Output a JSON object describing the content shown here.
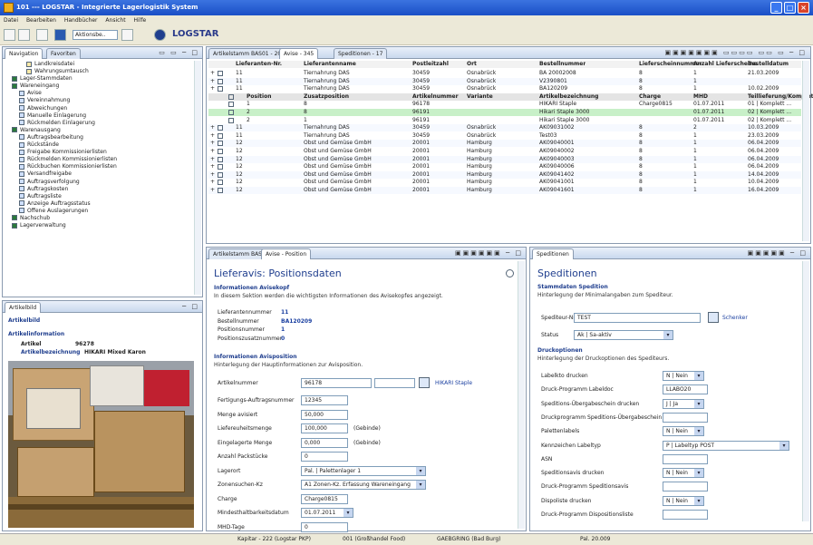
{
  "window": {
    "title": "101 --- LOGSTAR - Integrierte Lagerlogistik System"
  },
  "menu": [
    "Datei",
    "Bearbeiten",
    "Handbücher",
    "Ansicht",
    "Hilfe"
  ],
  "toolbar": {
    "combo": "Aktionsbe..",
    "brand": "LOGSTAR"
  },
  "nav": {
    "tabs": [
      "Navigation",
      "Favoriten"
    ],
    "items": [
      {
        "label": "Landkreisdatei",
        "indent": 3
      },
      {
        "label": "Wahrungsumtausch",
        "indent": 3
      },
      {
        "label": "Lager-Stammdaten",
        "indent": 1
      },
      {
        "label": "Wareneingang",
        "indent": 1
      },
      {
        "label": "Avise",
        "indent": 2
      },
      {
        "label": "Vereinnahmung",
        "indent": 2
      },
      {
        "label": "Abweichungen",
        "indent": 2
      },
      {
        "label": "Manuelle Einlagerung",
        "indent": 2
      },
      {
        "label": "Rückmelden Einlagerung",
        "indent": 2
      },
      {
        "label": "Warenausgang",
        "indent": 1
      },
      {
        "label": "Auftragsbearbeitung",
        "indent": 2
      },
      {
        "label": "Rückstände",
        "indent": 2
      },
      {
        "label": "Freigabe Kommissionierlisten",
        "indent": 2
      },
      {
        "label": "Rückmelden Kommissionierlisten",
        "indent": 2
      },
      {
        "label": "Rückbuchen Kommissionierlisten",
        "indent": 2
      },
      {
        "label": "Versandfreigabe",
        "indent": 2
      },
      {
        "label": "Auftragsverfolgung",
        "indent": 2
      },
      {
        "label": "Auftragskosten",
        "indent": 2
      },
      {
        "label": "Auftragsliste",
        "indent": 2
      },
      {
        "label": "Anzeige Auftragsstatus",
        "indent": 2
      },
      {
        "label": "Offene Auslagerungen",
        "indent": 2
      },
      {
        "label": "Nachschub",
        "indent": 1
      },
      {
        "label": "Lagerverwaltung",
        "indent": 1
      }
    ]
  },
  "article": {
    "tab": "Artikelbild",
    "title": "Artikelbild",
    "section": "Artikelinformation",
    "artikel_label": "Artikel",
    "artikel_value": "96278",
    "bez_label": "Artikelbezeichnung",
    "bez_value": "HIKARI Mixed Karon"
  },
  "grid": {
    "tabs": [
      "Artikelstamm BAS01 - 20",
      "Avise - 345",
      "Speditionen - 17"
    ],
    "headers": [
      "Lieferanten-Nr.",
      "Lieferantenname",
      "Postleitzahl",
      "Ort",
      "Bestellnummer",
      "Lieferscheinnummer",
      "Anzahl Lieferscheine",
      "Bestelldatum"
    ],
    "subheaders": [
      "Position",
      "Zusatzposition",
      "Artikelnummer",
      "Variante",
      "Artikelbezeichnung",
      "Charge",
      "MHD",
      "Teillieferung/Komplett"
    ],
    "rows": [
      {
        "t": "m",
        "c": [
          "11",
          "Tiernahrung DAS",
          "30459",
          "Osnabrück",
          "BA 20002008",
          "8",
          "1",
          "21.03.2009"
        ]
      },
      {
        "t": "m",
        "c": [
          "11",
          "Tiernahrung DAS",
          "30459",
          "Osnabrück",
          "V2390801",
          "8",
          "1",
          ""
        ]
      },
      {
        "t": "m",
        "c": [
          "11",
          "Tiernahrung DAS",
          "30459",
          "Osnabrück",
          "BA120209",
          "8",
          "1",
          "10.02.2009"
        ]
      },
      {
        "t": "h",
        "c": [
          "Position",
          "Zusatzposition",
          "Artikelnummer",
          "Variante",
          "Artikelbezeichnung",
          "Charge",
          "MHD",
          "Teillieferung/Komplett"
        ]
      },
      {
        "t": "s",
        "c": [
          "1",
          "8",
          "96178",
          "",
          "HIKARI Staple",
          "Charge0815",
          "01.07.2011",
          "01 | Komplett ..."
        ]
      },
      {
        "t": "g",
        "c": [
          "2",
          "8",
          "96191",
          "",
          "Hikari Staple 3000",
          "",
          "01.07.2011",
          "02 | Komplett ..."
        ]
      },
      {
        "t": "s",
        "c": [
          "2",
          "1",
          "96191",
          "",
          "Hikari Staple 3000",
          "",
          "01.07.2011",
          "02 | Komplett ..."
        ]
      },
      {
        "t": "m",
        "c": [
          "11",
          "Tiernahrung DAS",
          "30459",
          "Osnabrück",
          "AK09031002",
          "8",
          "2",
          "10.03.2009"
        ]
      },
      {
        "t": "m",
        "c": [
          "11",
          "Tiernahrung DAS",
          "30459",
          "Osnabrück",
          "Test03",
          "8",
          "1",
          "23.03.2009"
        ]
      },
      {
        "t": "m",
        "c": [
          "12",
          "Obst und Gemüse GmbH",
          "20001",
          "Hamburg",
          "AK09040001",
          "8",
          "1",
          "06.04.2009"
        ]
      },
      {
        "t": "m",
        "c": [
          "12",
          "Obst und Gemüse GmbH",
          "20001",
          "Hamburg",
          "AK09040002",
          "8",
          "1",
          "06.04.2009"
        ]
      },
      {
        "t": "m",
        "c": [
          "12",
          "Obst und Gemüse GmbH",
          "20001",
          "Hamburg",
          "AK09040003",
          "8",
          "1",
          "06.04.2009"
        ]
      },
      {
        "t": "m",
        "c": [
          "12",
          "Obst und Gemüse GmbH",
          "20001",
          "Hamburg",
          "AK09040006",
          "8",
          "1",
          "06.04.2009"
        ]
      },
      {
        "t": "m",
        "c": [
          "12",
          "Obst und Gemüse GmbH",
          "20001",
          "Hamburg",
          "AK09041402",
          "8",
          "1",
          "14.04.2009"
        ]
      },
      {
        "t": "m",
        "c": [
          "12",
          "Obst und Gemüse GmbH",
          "20001",
          "Hamburg",
          "AK09041001",
          "8",
          "1",
          "10.04.2009"
        ]
      },
      {
        "t": "m",
        "c": [
          "12",
          "Obst und Gemüse GmbH",
          "20001",
          "Hamburg",
          "AK09041601",
          "8",
          "1",
          "16.04.2009"
        ]
      }
    ]
  },
  "form": {
    "tabs": [
      "Artikelstamm BAS01",
      "Avise - Position"
    ],
    "title": "Lieferavis: Positionsdaten",
    "sec1": "Informationen Avisekopf",
    "sec1desc": "In diesem Sektion werden die wichtigsten Informationen des Avisekopfes angezeigt.",
    "kopf": [
      {
        "l": "Lieferantennummer",
        "v": "11"
      },
      {
        "l": "Bestellnummer",
        "v": "BA120209"
      },
      {
        "l": "Positionsnummer",
        "v": "1"
      },
      {
        "l": "Positionszusatznummer",
        "v": "0"
      }
    ],
    "sec2": "Informationen Avisposition",
    "sec2desc": "Hinterlegung der Hauptinformationen zur Avisposition.",
    "artikel_label": "Artikelnummer",
    "artikel_value": "96178",
    "artikel_link": "HIKARI Staple",
    "fields": [
      {
        "l": "Fertigungs-Auftragsnummer",
        "v": "12345"
      },
      {
        "l": "Menge avisiert",
        "v": "50,000"
      },
      {
        "l": "Liefereuheitsmenge",
        "v": "100,000",
        "u": "(Gebinde)"
      },
      {
        "l": "Eingelagerte Menge",
        "v": "0,000",
        "u": "(Gebinde)"
      },
      {
        "l": "Anzahl Packstücke",
        "v": "0"
      },
      {
        "l": "Lagerort",
        "v": "Pal. | Palettenlager 1",
        "sel": true
      },
      {
        "l": "Zonensuchen-Kz",
        "v": "A1 Zonen-Kz. Erfassung Wareneingang",
        "sel": true
      },
      {
        "l": "Charge",
        "v": "Charge0815"
      },
      {
        "l": "Mindesthaltbarkeitsdatum",
        "v": "01.07.2011",
        "sel": true
      },
      {
        "l": "MHD-Tage",
        "v": "0"
      }
    ]
  },
  "spedition": {
    "tab": "Speditionen",
    "title": "Speditionen",
    "sec1": "Stammdaten Spedition",
    "sec1desc": "Hinterlegung der Minimalangaben zum Spediteur.",
    "nr_label": "Spediteur-Nr.",
    "nr_value": "TEST",
    "schenker": "Schenker",
    "status_label": "Status",
    "status_value": "Ak | Sa-aktiv",
    "sec2": "Druckoptionen",
    "sec2desc": "Hinterlegung der Druckoptionen des Spediteurs.",
    "fields": [
      {
        "l": "Labelkto drucken",
        "v": "N | Nein",
        "sel": true
      },
      {
        "l": "Druck-Programm Labeldoc",
        "v": "LLABO20"
      },
      {
        "l": "Speditions-Übergabeschein drucken",
        "v": "J | Ja",
        "sel": true
      },
      {
        "l": "Druckprogramm Speditions-Übergabeschein",
        "v": ""
      },
      {
        "l": "Palettenlabels",
        "v": "N | Nein",
        "sel": true
      },
      {
        "l": "Kennzeichen Labeltyp",
        "v": "P | Labeltyp POST",
        "sel": true,
        "wide": true
      },
      {
        "l": "ASN",
        "v": ""
      },
      {
        "l": "Speditionsavis drucken",
        "v": "N | Nein",
        "sel": true
      },
      {
        "l": "Druck-Programm Speditionsavis",
        "v": ""
      },
      {
        "l": "Dispoliste drucken",
        "v": "N | Nein",
        "sel": true
      },
      {
        "l": "Druck-Programm Dispositionsliste",
        "v": ""
      }
    ]
  },
  "status": [
    "Kapitar - 222 (Logstar PKP)",
    "001 (Großhandel Food)",
    "GAEBGRING (Bad Burg)",
    "Pal. 20.009"
  ]
}
